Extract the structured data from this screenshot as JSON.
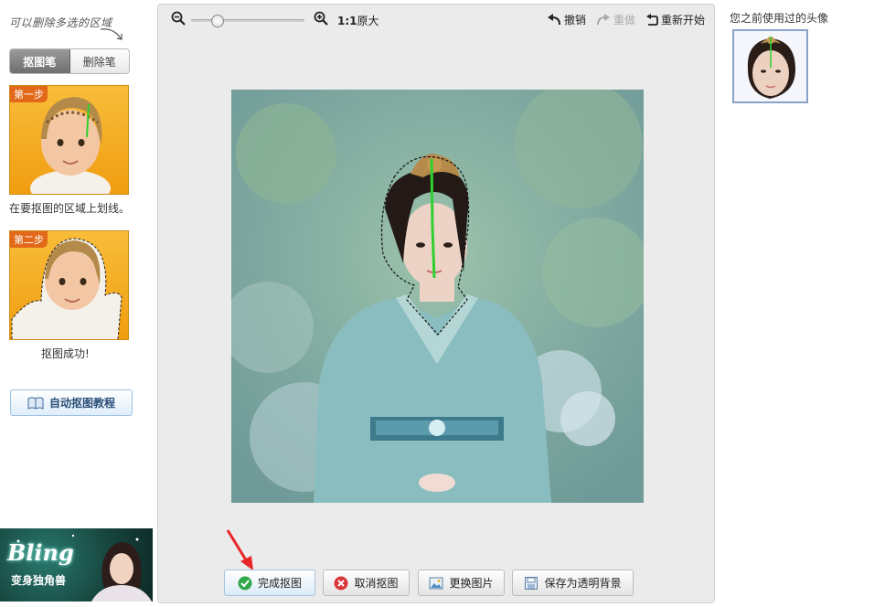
{
  "left_panel": {
    "hint": "可以删除多选的区域",
    "tabs": [
      {
        "label": "抠图笔",
        "active": true
      },
      {
        "label": "删除笔",
        "active": false
      }
    ],
    "step1": {
      "label": "第一步",
      "caption": "在要抠图的区域上划线。"
    },
    "step2": {
      "label": "第二步",
      "caption": "抠图成功!"
    },
    "tutorial_button": "自动抠图教程",
    "banner": {
      "title": "Bling",
      "subtitle": "变身独角兽"
    }
  },
  "toolbar": {
    "zoom_level": 0.2,
    "zoom_ratio": "1:1",
    "zoom_text": "原大",
    "undo": "撤销",
    "redo": "重做",
    "restart": "重新开始"
  },
  "actions": {
    "complete": "完成抠图",
    "cancel": "取消抠图",
    "change_image": "更换图片",
    "save_transparent": "保存为透明背景"
  },
  "right_panel": {
    "title": "您之前使用过的头像"
  },
  "colors": {
    "accent_blue": "#2a4f78",
    "step_orange": "#f19d10",
    "step_label": "#e2681a",
    "stroke_green": "#2fd02f",
    "arrow_red": "#e8262a"
  }
}
